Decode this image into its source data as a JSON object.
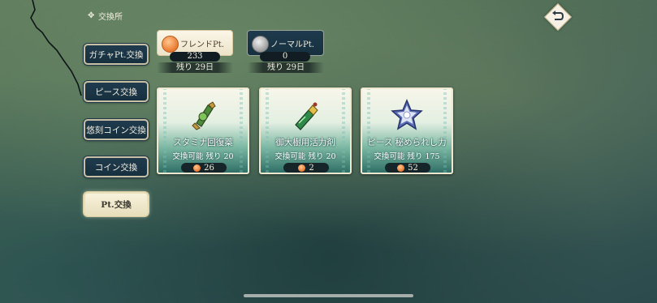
{
  "header": {
    "title": "交換所",
    "title_icon": "cross-ornament-icon",
    "back_icon": "back-arrow-icon"
  },
  "sidebar": {
    "items": [
      {
        "label": "ガチャPt.交換",
        "active": false
      },
      {
        "label": "ピース交換",
        "active": false
      },
      {
        "label": "悠刻コイン交換",
        "active": false
      },
      {
        "label": "コイン交換",
        "active": false
      },
      {
        "label": "Pt.交換",
        "active": true
      }
    ]
  },
  "points": {
    "friend": {
      "label": "フレンドPt.",
      "value": "233",
      "remaining": "残り 29日",
      "color": "#e9792f"
    },
    "normal": {
      "label": "ノーマルPt.",
      "value": "0",
      "remaining": "残り 29日",
      "color": "#9c9c9c"
    }
  },
  "cards": [
    {
      "name": "スタミナ回復薬",
      "availability": "交換可能 残り 20",
      "cost": "26",
      "icon": "stamina-potion-icon"
    },
    {
      "name": "御大樹用活力剤",
      "availability": "交換可能 残り 20",
      "cost": "2",
      "icon": "vitality-bottle-icon"
    },
    {
      "name": "ピース 秘められし力",
      "availability": "交換可能 残り 175",
      "cost": "52",
      "icon": "star-piece-icon"
    }
  ]
}
